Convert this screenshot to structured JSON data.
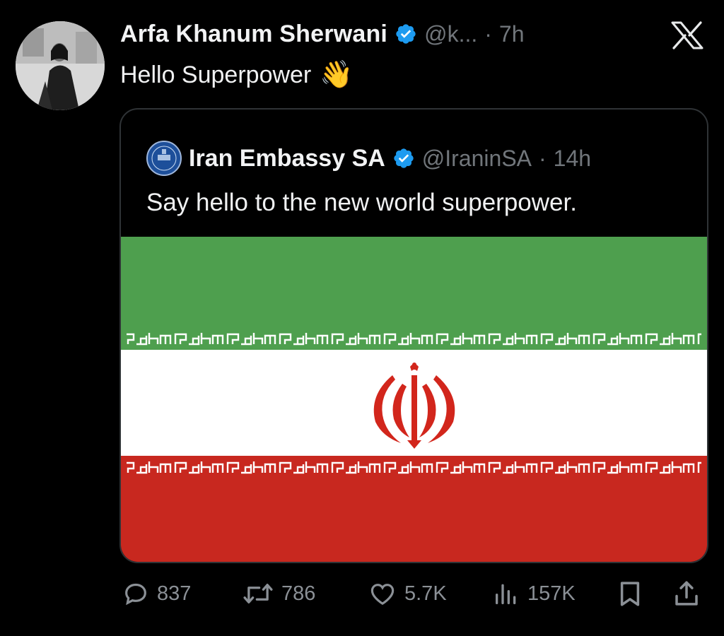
{
  "tweet": {
    "author_name": "Arfa Khanum Sherwani",
    "author_handle": "@k...",
    "time": "7h",
    "text": "Hello Superpower",
    "emoji": "👋"
  },
  "quoted_tweet": {
    "author_name": "Iran Embassy SA",
    "author_handle": "@IraninSA",
    "time": "14h",
    "text": "Say hello to the new world superpower."
  },
  "actions": {
    "replies": "837",
    "reposts": "786",
    "likes": "5.7K",
    "views": "157K"
  },
  "icons": {
    "platform_logo": "x-logo-icon",
    "verified": "verified-badge-icon",
    "reply": "reply-icon",
    "repost": "repost-icon",
    "like": "heart-icon",
    "views": "views-icon",
    "bookmark": "bookmark-icon",
    "share": "share-icon"
  },
  "colors": {
    "background": "#000000",
    "verified_blue": "#1d9bf0",
    "secondary_text": "#71767b",
    "flag_green": "#4e9f4e",
    "flag_white": "#ffffff",
    "flag_red": "#c8281f"
  }
}
